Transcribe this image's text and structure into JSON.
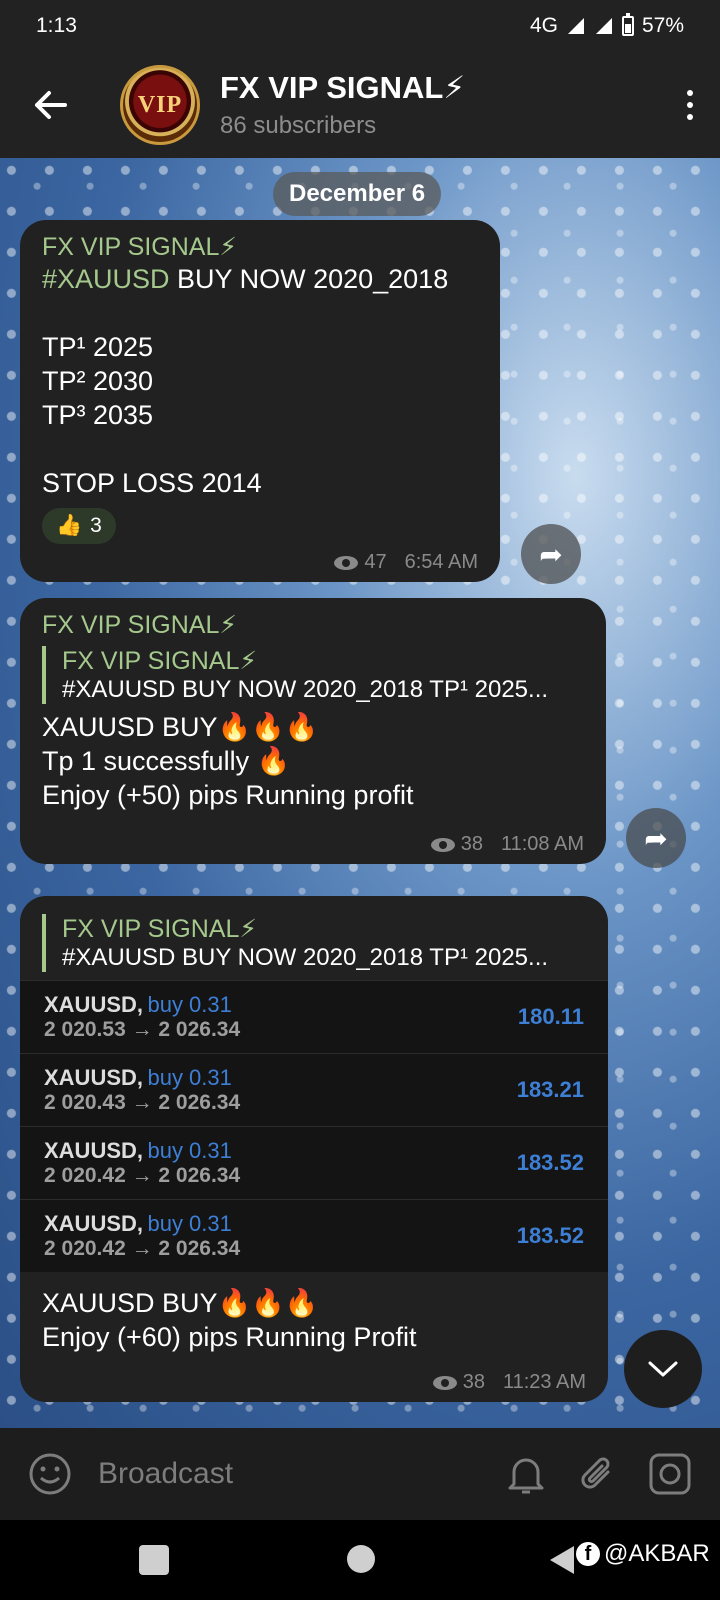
{
  "status_bar": {
    "time": "1:13",
    "network": "4G",
    "battery": "57%"
  },
  "header": {
    "avatar_text": "VIP",
    "title": "FX VIP SIGNAL⚡",
    "subtitle": "86 subscribers"
  },
  "date_separator": "December 6",
  "messages": [
    {
      "sender": "FX VIP SIGNAL⚡",
      "hashtag": "#XAUUSD",
      "line1_rest": " BUY NOW 2020_2018",
      "tp1": "TP¹ 2025",
      "tp2": "TP² 2030",
      "tp3": "TP³ 2035",
      "stop_loss": "STOP LOSS 2014",
      "reaction_emoji": "👍",
      "reaction_count": "3",
      "views": "47",
      "time": "6:54 AM"
    },
    {
      "sender": "FX VIP SIGNAL⚡",
      "reply_title": "FX VIP SIGNAL⚡",
      "reply_text": "#XAUUSD BUY NOW 2020_2018  TP¹ 2025...",
      "line1": "XAUUSD BUY🔥🔥🔥",
      "line2": "Tp 1 successfully 🔥",
      "line3": "Enjoy (+50) pips Running profit",
      "views": "38",
      "time": "11:08 AM"
    },
    {
      "reply_title": "FX VIP SIGNAL⚡",
      "reply_text": "#XAUUSD BUY NOW 2020_2018  TP¹ 2025...",
      "trades": [
        {
          "symbol": "XAUUSD,",
          "side": "buy 0.31",
          "prices": "2 020.53 → 2 026.34",
          "profit": "180.11"
        },
        {
          "symbol": "XAUUSD,",
          "side": "buy 0.31",
          "prices": "2 020.43 → 2 026.34",
          "profit": "183.21"
        },
        {
          "symbol": "XAUUSD,",
          "side": "buy 0.31",
          "prices": "2 020.42 → 2 026.34",
          "profit": "183.52"
        },
        {
          "symbol": "XAUUSD,",
          "side": "buy 0.31",
          "prices": "2 020.42 → 2 026.34",
          "profit": "183.52"
        }
      ],
      "line1": "XAUUSD BUY🔥🔥🔥",
      "line2": "Enjoy (+60) pips Running Profit",
      "views": "38",
      "time": "11:23 AM"
    }
  ],
  "input": {
    "placeholder": "Broadcast"
  },
  "watermark": "@AKBAR",
  "colors": {
    "accent_green": "#a5c98d",
    "profit_blue": "#3e7fd6",
    "bubble": "#212121",
    "header": "#222222"
  }
}
